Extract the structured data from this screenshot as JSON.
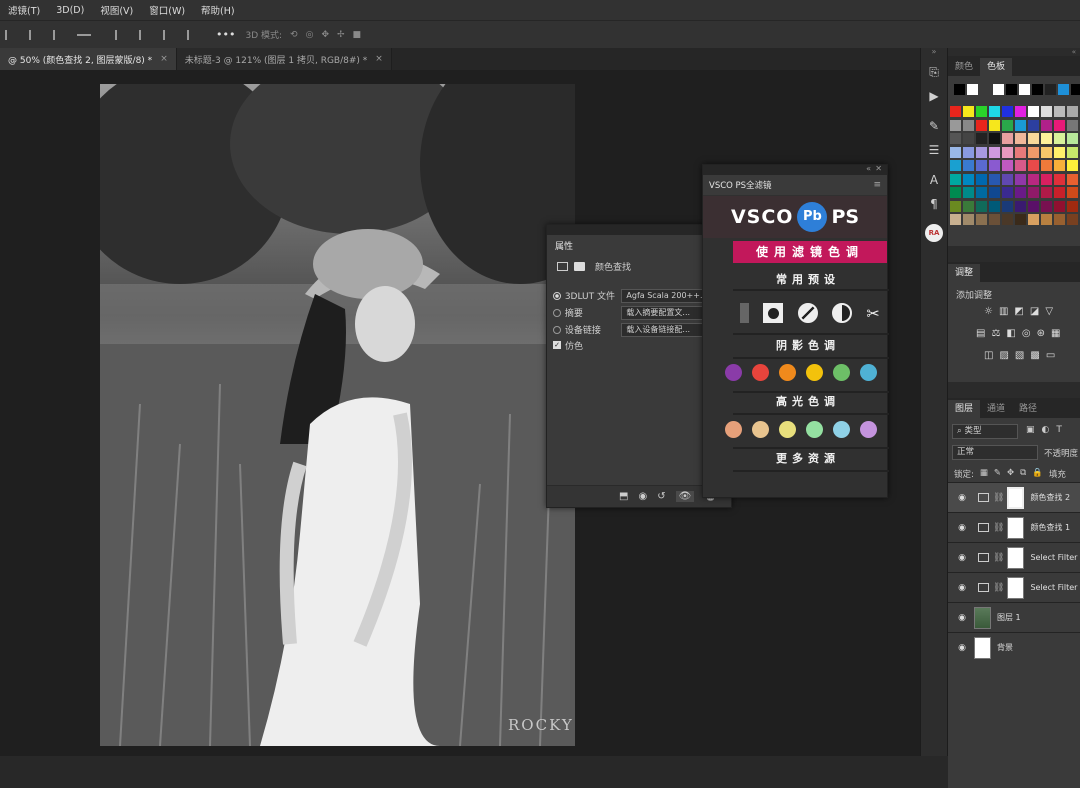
{
  "menubar": {
    "items": [
      "滤镜(T)",
      "3D(D)",
      "视图(V)",
      "窗口(W)",
      "帮助(H)"
    ]
  },
  "options_bar": {
    "mode_label": "3D 模式:",
    "more": "•••"
  },
  "tabs": [
    {
      "label": "@ 50% (颜色查找 2, 图层蒙版/8) *",
      "close": "×"
    },
    {
      "label": "未标题-3 @ 121% (图层 1 拷贝, RGB/8#) *",
      "close": "×"
    }
  ],
  "watermark": "ROCKY",
  "properties": {
    "title": "属性",
    "subtitle": "颜色查找",
    "options": [
      {
        "label": "3DLUT 文件",
        "value": "Agfa Scala 200++..."
      },
      {
        "label": "摘要",
        "value": "载入摘要配置文..."
      },
      {
        "label": "设备链接",
        "value": "载入设备链接配..."
      }
    ],
    "dither_label": "仿色"
  },
  "vsco": {
    "title": "VSCO PS全滤镜",
    "logo_left": "VSCO",
    "logo_mid": "Pb",
    "logo_right": "PS",
    "banner": "使用滤镜色调",
    "presets_label": "常用预设",
    "shadow_label": "阴影色调",
    "shadow_colors": [
      "#8a3ba8",
      "#e8443c",
      "#f08a1c",
      "#f3c20c",
      "#6dbf67",
      "#4fb1d4"
    ],
    "highlight_label": "高光色调",
    "highlight_colors": [
      "#e6a07a",
      "#e8c48f",
      "#e8df7c",
      "#94e0a1",
      "#8fd1e6",
      "#c493dd"
    ],
    "more_label": "更多资源"
  },
  "swatches_panel": {
    "tabs": [
      "颜色",
      "色板"
    ]
  },
  "adjustments_panel": {
    "tab": "调整",
    "add_label": "添加调整"
  },
  "layers_panel": {
    "tabs": [
      "图层",
      "通道",
      "路径"
    ],
    "filter_kind": "类型",
    "blend_mode": "正常",
    "opacity_label": "不透明度",
    "lock_label": "锁定:",
    "fill_label": "填充",
    "layers": [
      {
        "name": "颜色查找 2"
      },
      {
        "name": "颜色查找 1"
      },
      {
        "name": "Select Filter"
      },
      {
        "name": "Select Filter"
      },
      {
        "name": "图层 1"
      },
      {
        "name": "背景"
      }
    ]
  },
  "toolstrip": {
    "ra_label": "RA"
  }
}
